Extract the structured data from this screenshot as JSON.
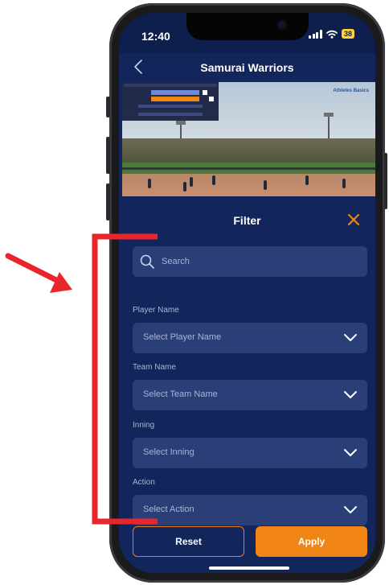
{
  "status_bar": {
    "time": "12:40",
    "battery": "38"
  },
  "nav": {
    "title": "Samurai Warriors"
  },
  "video": {
    "brand": "Athletes Basics"
  },
  "filter": {
    "title": "Filter",
    "search_placeholder": "Search",
    "fields": [
      {
        "label": "Player Name",
        "placeholder": "Select Player Name"
      },
      {
        "label": "Team Name",
        "placeholder": "Select Team Name"
      },
      {
        "label": "Inning",
        "placeholder": "Select Inning"
      },
      {
        "label": "Action",
        "placeholder": "Select Action"
      }
    ],
    "reset_label": "Reset",
    "apply_label": "Apply"
  },
  "colors": {
    "background": "#13265c",
    "input": "#2a3f78",
    "accent": "#f08516",
    "annotation": "#e8262b"
  }
}
